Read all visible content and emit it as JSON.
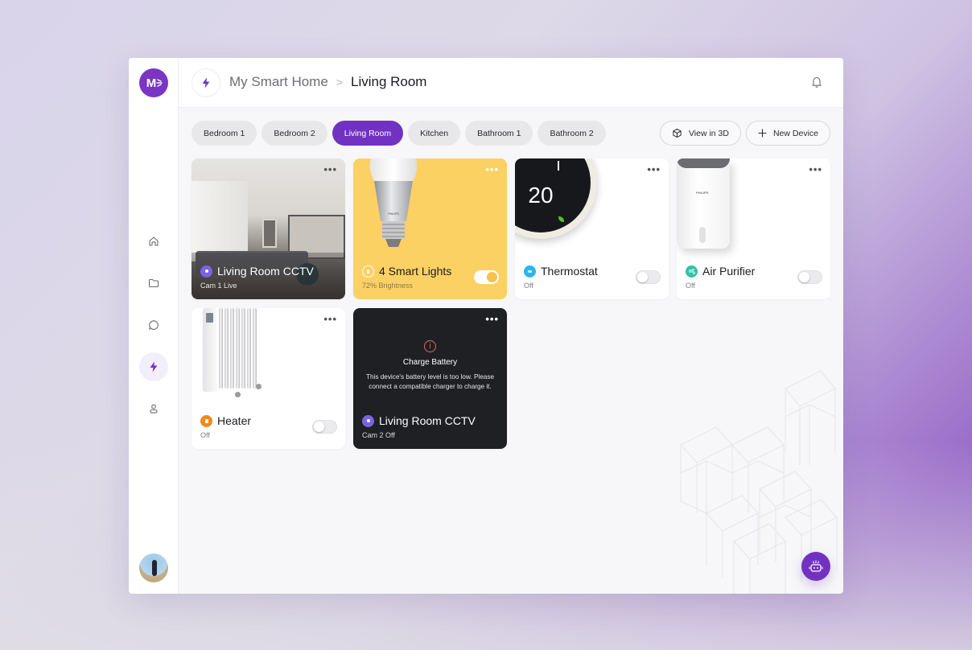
{
  "app": {
    "logo_text": "M",
    "accent_color": "#7132c1"
  },
  "sidebar": {
    "items": [
      {
        "name": "home",
        "icon": "home-icon",
        "active": false
      },
      {
        "name": "folder",
        "icon": "folder-icon",
        "active": false
      },
      {
        "name": "messages",
        "icon": "chat-icon",
        "active": false
      },
      {
        "name": "devices",
        "icon": "lightning-icon",
        "active": true
      },
      {
        "name": "profile",
        "icon": "user-icon",
        "active": false
      }
    ]
  },
  "header": {
    "breadcrumb_root": "My Smart Home",
    "breadcrumb_separator": ">",
    "breadcrumb_current": "Living Room"
  },
  "tabs": [
    {
      "label": "Bedroom 1",
      "active": false
    },
    {
      "label": "Bedroom 2",
      "active": false
    },
    {
      "label": "Living Room",
      "active": true
    },
    {
      "label": "Kitchen",
      "active": false
    },
    {
      "label": "Bathroom 1",
      "active": false
    },
    {
      "label": "Bathroom 2",
      "active": false
    }
  ],
  "actions": {
    "view_3d": "View in 3D",
    "new_device": "New Device"
  },
  "devices": [
    {
      "name": "Living Room CCTV",
      "status": "Cam 1 Live",
      "type": "camera",
      "icon_color": "#7b63e0"
    },
    {
      "name": "4 Smart Lights",
      "status": "72% Brightness",
      "type": "lights",
      "on": true,
      "brightness_percent": 72
    },
    {
      "name": "Thermostat",
      "status": "Off",
      "type": "thermostat",
      "on": false,
      "display_temp": "20",
      "icon_color": "#29b6f0"
    },
    {
      "name": "Air Purifier",
      "status": "Off",
      "type": "purifier",
      "on": false,
      "icon_color": "#2fc2a6",
      "brand": "PHILIPS"
    },
    {
      "name": "Heater",
      "status": "Off",
      "type": "heater",
      "on": false,
      "icon_color": "#f28a1c"
    },
    {
      "name": "Living Room CCTV",
      "status": "Cam 2 Off",
      "type": "camera",
      "icon_color": "#7b63e0",
      "alert": {
        "title": "Charge Battery",
        "message": "This device's battery level is too low. Please connect a compatible charger to charge it."
      }
    }
  ],
  "menu_label": "•••"
}
